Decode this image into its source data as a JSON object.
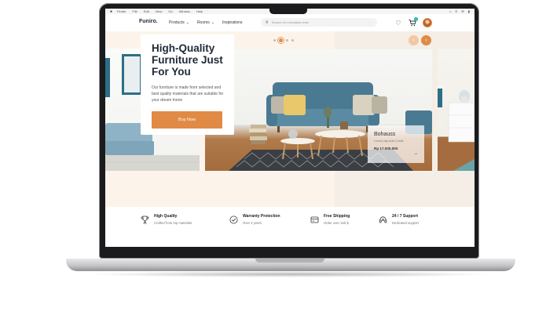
{
  "menubar": {
    "items": [
      "Finder",
      "File",
      "Edit",
      "View",
      "Go",
      "Window",
      "Help"
    ]
  },
  "header": {
    "logo": "Funiro.",
    "nav": [
      {
        "label": "Products",
        "has_dropdown": true
      },
      {
        "label": "Rooms",
        "has_dropdown": true
      },
      {
        "label": "Inspirations",
        "has_dropdown": false
      }
    ],
    "search_placeholder": "Search for minimalist chair",
    "cart_count": "1"
  },
  "hero": {
    "title": "High-Quality Furniture Just For You",
    "description": "Our furniture is made from selected and best quality materials that are suitable for your dream home",
    "cta_label": "Buy Now",
    "carousel_dots": 4,
    "active_dot": 1
  },
  "product_tag": {
    "name": "Bohauss",
    "subtitle": "Luxury big sofa 2-seat",
    "price": "Rp 17.000.000"
  },
  "features": [
    {
      "icon": "trophy-icon",
      "title": "High Quality",
      "subtitle": "Crafted from top materials"
    },
    {
      "icon": "check-circle-icon",
      "title": "Warranty Protection",
      "subtitle": "Over 2 years"
    },
    {
      "icon": "shipping-icon",
      "title": "Free Shipping",
      "subtitle": "Order over 150 $"
    },
    {
      "icon": "headset-icon",
      "title": "24 / 7 Support",
      "subtitle": "Dedicated support"
    }
  ],
  "colors": {
    "accent": "#E08A46",
    "hero_bg": "#FCF4EA",
    "sofa": "#4A7A92",
    "text_dark": "#1F2937"
  }
}
